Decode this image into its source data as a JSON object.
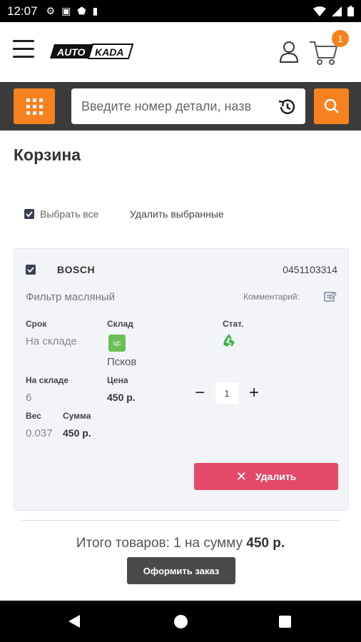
{
  "status_bar": {
    "time": "12:07"
  },
  "header": {
    "logo_text": "AUTO KADA",
    "cart_count": "1"
  },
  "search": {
    "placeholder": "Введите номер детали, назв"
  },
  "page": {
    "title": "Корзина"
  },
  "selection": {
    "select_all": "Выбрать все",
    "delete_selected": "Удалить выбранные"
  },
  "cart_item": {
    "brand": "BOSCH",
    "article": "0451103314",
    "name": "Фильтр масляный",
    "comment_label": "Комментарий:",
    "term_label": "Срок",
    "term_value": "На складе",
    "warehouse_label": "Склад",
    "warehouse_badge": "цс",
    "warehouse_value": "Псков",
    "stat_label": "Стат.",
    "stock_label": "На складе",
    "stock_value": "6",
    "price_label": "Цена",
    "price_value": "450 р.",
    "quantity": "1",
    "weight_label": "Вес",
    "weight_value": "0.037",
    "sum_label": "Сумма",
    "sum_value": "450 р.",
    "delete_label": "Удалить"
  },
  "summary": {
    "text": "Итого товаров: 1 на сумму",
    "amount": "450 р.",
    "order_button": "Оформить заказ"
  },
  "colors": {
    "accent": "#f5821f",
    "danger": "#e24a68",
    "stock_green": "#6bbf59"
  }
}
